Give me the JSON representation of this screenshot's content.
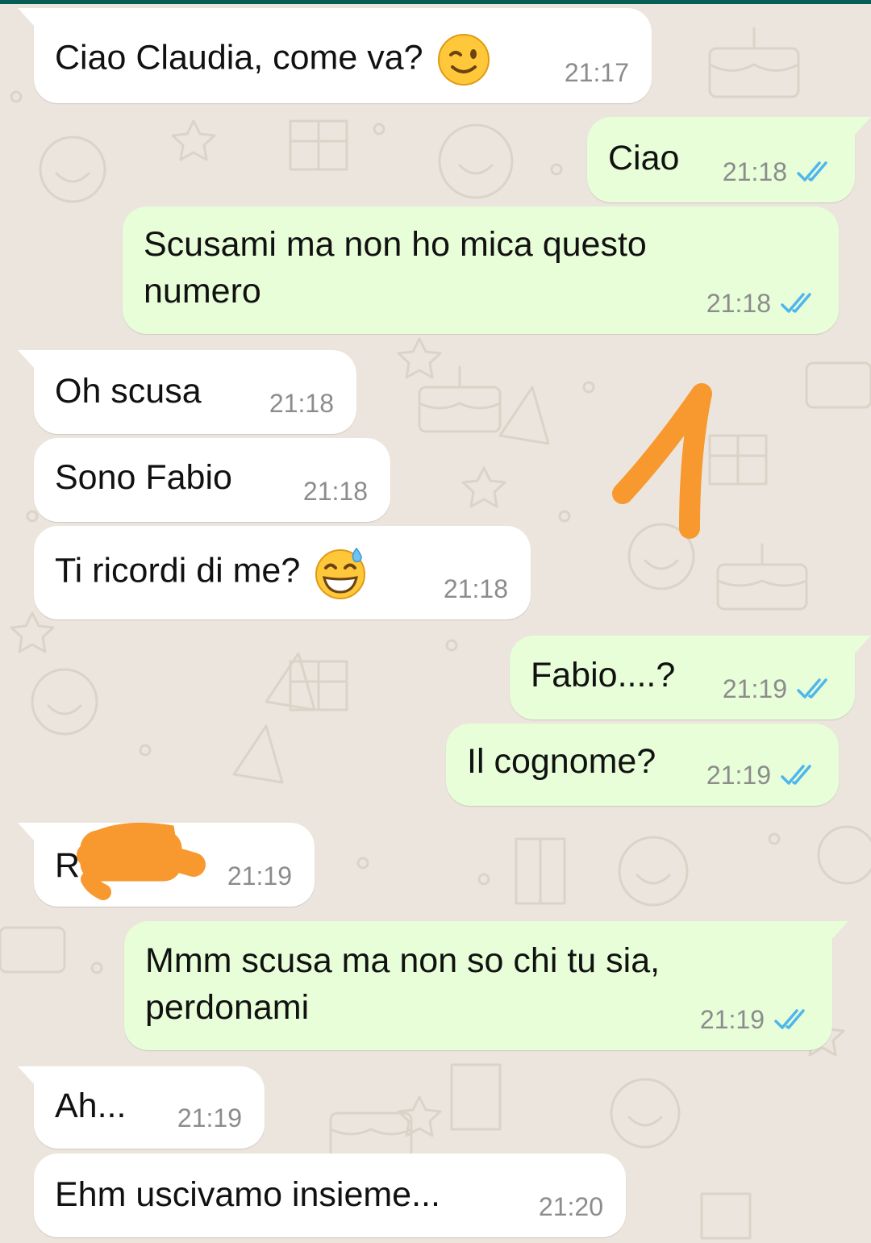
{
  "messages": [
    {
      "id": "m1",
      "dir": "in",
      "text": "Ciao Claudia, come va?",
      "emoji": "wink-face",
      "time": "21:17"
    },
    {
      "id": "m2",
      "dir": "out",
      "text": "Ciao",
      "time": "21:18",
      "status": "read"
    },
    {
      "id": "m3",
      "dir": "out",
      "text_lines": [
        "Scusami ma non ho mica questo",
        "numero"
      ],
      "time": "21:18",
      "status": "read"
    },
    {
      "id": "m4",
      "dir": "in",
      "text": "Oh scusa",
      "time": "21:18"
    },
    {
      "id": "m5",
      "dir": "in",
      "text": "Sono Fabio",
      "time": "21:18"
    },
    {
      "id": "m6",
      "dir": "in",
      "text": "Ti ricordi di me?",
      "emoji": "grinning-sweat-face",
      "time": "21:18"
    },
    {
      "id": "m7",
      "dir": "out",
      "text": "Fabio....?",
      "time": "21:19",
      "status": "read"
    },
    {
      "id": "m8",
      "dir": "out",
      "text": "Il cognome?",
      "time": "21:19",
      "status": "read"
    },
    {
      "id": "m9",
      "dir": "in",
      "text": "R",
      "time": "21:19",
      "redacted": true
    },
    {
      "id": "m10",
      "dir": "out",
      "text_lines": [
        "Mmm scusa ma non so chi tu sia,",
        "perdonami"
      ],
      "time": "21:19",
      "status": "read"
    },
    {
      "id": "m11",
      "dir": "in",
      "text": "Ah...",
      "time": "21:19"
    },
    {
      "id": "m12",
      "dir": "in",
      "text": "Ehm uscivamo insieme...",
      "time": "21:20"
    }
  ],
  "annotation": {
    "text": "1"
  },
  "colors": {
    "incoming_bubble": "#ffffff",
    "outgoing_bubble": "#e7fed8",
    "read_ticks": "#4fb6ec",
    "timestamp": "#8c8c8c",
    "annotation": "#f7992e",
    "wallpaper": "#ece5dd"
  }
}
